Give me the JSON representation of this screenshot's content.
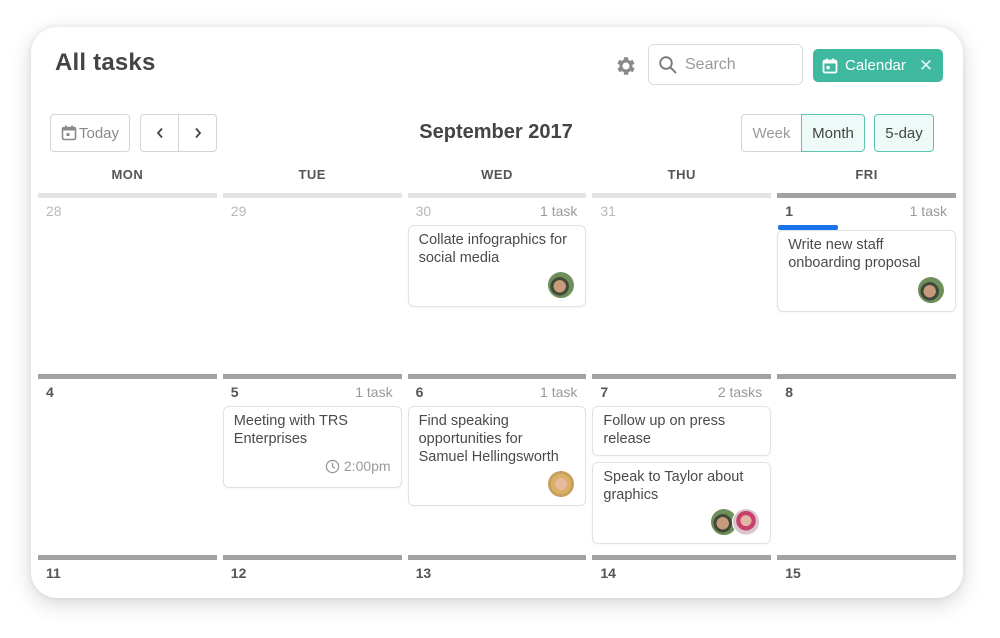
{
  "header": {
    "title": "All tasks",
    "settings_icon": "gear-icon",
    "search": {
      "placeholder": "Search",
      "value": "",
      "icon": "search-icon"
    },
    "filter_chip": {
      "label": "Calendar",
      "icon": "calendar-icon",
      "close_icon": "close-icon",
      "color": "#3fb8a0"
    }
  },
  "toolbar": {
    "today_label": "Today",
    "prev_label": "‹",
    "next_label": "›",
    "month_title": "September 2017",
    "views": [
      {
        "label": "Week",
        "active": false
      },
      {
        "label": "Month",
        "active": true
      },
      {
        "label": "5-day",
        "active": true
      }
    ]
  },
  "calendar": {
    "weekdays": [
      "MON",
      "TUE",
      "WED",
      "THU",
      "FRI"
    ],
    "weeks": [
      {
        "days": [
          {
            "num": "28",
            "muted": true,
            "count": "",
            "tasks": []
          },
          {
            "num": "29",
            "muted": true,
            "count": "",
            "tasks": []
          },
          {
            "num": "30",
            "muted": true,
            "count": "1 task",
            "tasks": [
              {
                "title": "Collate infographics for social media",
                "avatars": [
                  "a1"
                ]
              }
            ]
          },
          {
            "num": "31",
            "muted": true,
            "count": "",
            "tasks": []
          },
          {
            "num": "1",
            "muted": false,
            "count": "1 task",
            "tasks": [
              {
                "title": "Write new staff onboarding proposal",
                "avatars": [
                  "a1"
                ],
                "accent": "#1a73e8"
              }
            ]
          }
        ]
      },
      {
        "days": [
          {
            "num": "4",
            "muted": false,
            "count": "",
            "tasks": []
          },
          {
            "num": "5",
            "muted": false,
            "count": "1 task",
            "tasks": [
              {
                "title": "Meeting with TRS Enterprises",
                "time": "2:00pm"
              }
            ]
          },
          {
            "num": "6",
            "muted": false,
            "count": "1 task",
            "tasks": [
              {
                "title": "Find speaking opportunities for Samuel Hellingsworth",
                "avatars": [
                  "a2"
                ]
              }
            ]
          },
          {
            "num": "7",
            "muted": false,
            "count": "2 tasks",
            "tasks": [
              {
                "title": "Follow up on press release"
              },
              {
                "title": "Speak to Taylor about graphics",
                "avatars": [
                  "a1",
                  "a3"
                ]
              }
            ]
          },
          {
            "num": "8",
            "muted": false,
            "count": "",
            "tasks": []
          }
        ]
      },
      {
        "days": [
          {
            "num": "11",
            "muted": false,
            "count": "",
            "tasks": []
          },
          {
            "num": "12",
            "muted": false,
            "count": "",
            "tasks": []
          },
          {
            "num": "13",
            "muted": false,
            "count": "",
            "tasks": []
          },
          {
            "num": "14",
            "muted": false,
            "count": "",
            "tasks": []
          },
          {
            "num": "15",
            "muted": false,
            "count": "",
            "tasks": []
          }
        ]
      }
    ]
  }
}
